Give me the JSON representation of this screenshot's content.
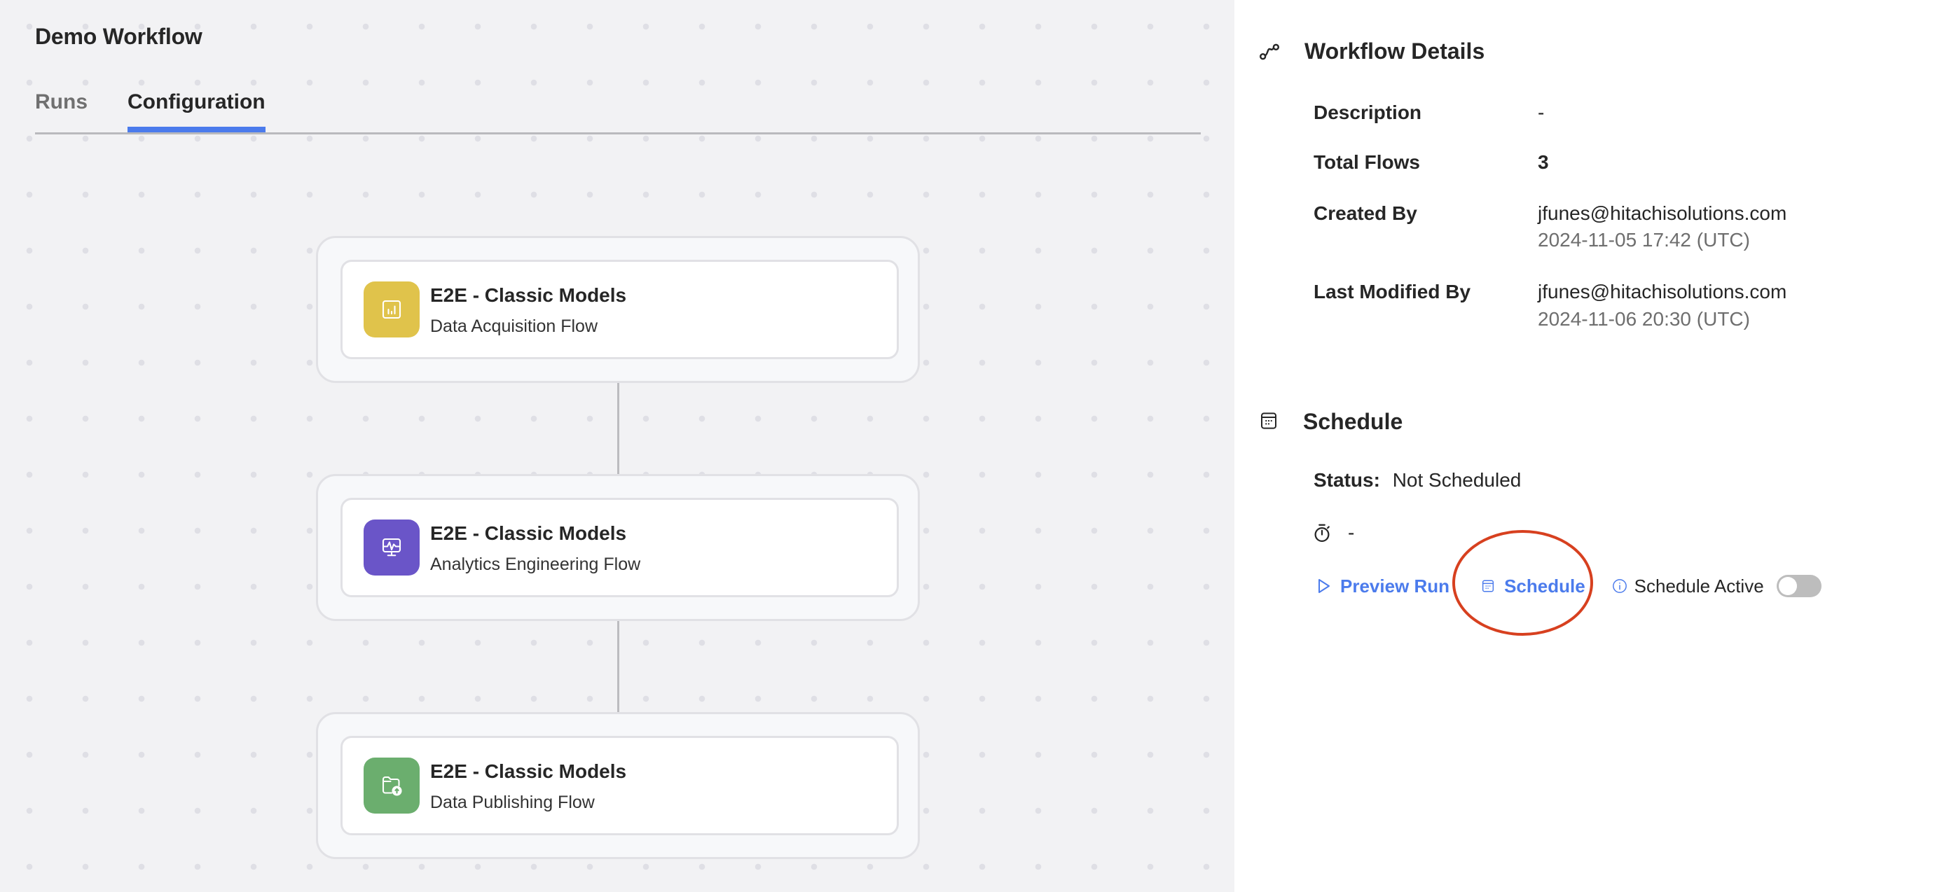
{
  "page": {
    "title": "Demo Workflow",
    "tabs": [
      {
        "label": "Runs",
        "active": false
      },
      {
        "label": "Configuration",
        "active": true
      }
    ]
  },
  "flows": [
    {
      "title": "E2E - Classic Models",
      "subtitle": "Data Acquisition Flow",
      "icon": "bar-chart-icon",
      "color": "#E0C34B"
    },
    {
      "title": "E2E - Classic Models",
      "subtitle": "Analytics Engineering Flow",
      "icon": "monitor-pulse-icon",
      "color": "#6A55C8"
    },
    {
      "title": "E2E - Classic Models",
      "subtitle": "Data Publishing Flow",
      "icon": "folder-upload-icon",
      "color": "#6BAE6E"
    }
  ],
  "details": {
    "title": "Workflow Details",
    "icon": "workflow-icon",
    "rows": [
      {
        "label": "Description",
        "value": "-"
      },
      {
        "label": "Total Flows",
        "value": "3"
      },
      {
        "label": "Created By",
        "value": "jfunes@hitachisolutions.com",
        "sub": "2024-11-05 17:42 (UTC)"
      },
      {
        "label": "Last Modified By",
        "value": "jfunes@hitachisolutions.com",
        "sub": "2024-11-06 20:30 (UTC)"
      }
    ]
  },
  "schedule": {
    "title": "Schedule",
    "icon": "calendar-icon",
    "status_label": "Status:",
    "status_value": "Not Scheduled",
    "timer_value": "-",
    "preview_run_label": "Preview Run",
    "schedule_button_label": "Schedule",
    "schedule_active_label": "Schedule Active",
    "schedule_active": false
  },
  "colors": {
    "accent": "#4B7BEC",
    "highlight": "#D7401F"
  }
}
